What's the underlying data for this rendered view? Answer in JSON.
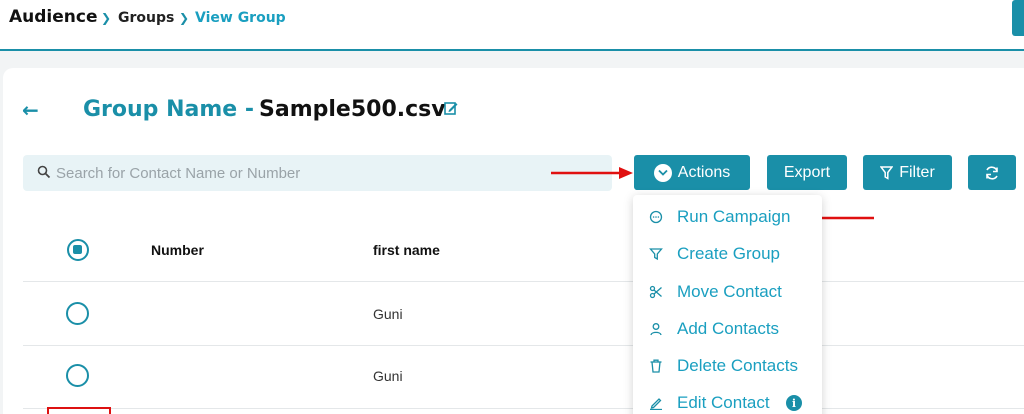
{
  "breadcrumb": {
    "root": "Audience",
    "groups": "Groups",
    "current": "View Group"
  },
  "header": {
    "title_label": "Group Name -",
    "title_value": "Sample500.csv"
  },
  "search": {
    "placeholder": "Search for Contact Name or Number",
    "value": ""
  },
  "toolbar": {
    "actions_label": "Actions",
    "export_label": "Export",
    "filter_label": "Filter"
  },
  "table": {
    "columns": [
      "Number",
      "first name"
    ],
    "rows": [
      {
        "number": "",
        "first_name": "Guni"
      },
      {
        "number": "",
        "first_name": "Guni"
      }
    ]
  },
  "actions_menu": {
    "items": [
      {
        "label": "Run Campaign",
        "icon": "chat-bubble-icon"
      },
      {
        "label": "Create Group",
        "icon": "filter-icon"
      },
      {
        "label": "Move Contact",
        "icon": "scissors-icon"
      },
      {
        "label": "Add Contacts",
        "icon": "user-icon"
      },
      {
        "label": "Delete Contacts",
        "icon": "trash-icon"
      },
      {
        "label": "Edit Contact",
        "icon": "pencil-icon",
        "info": "i"
      }
    ]
  },
  "colors": {
    "accent": "#1a8fa8",
    "link": "#1a9fc0",
    "annotation": "#e01010"
  }
}
